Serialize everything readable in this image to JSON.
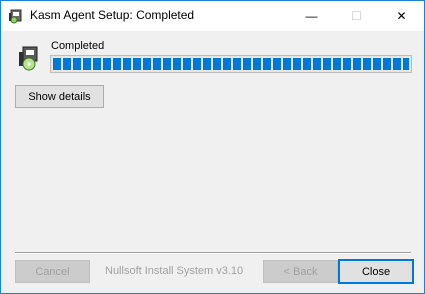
{
  "window": {
    "title": "Kasm Agent Setup: Completed",
    "border_color": "#1883d7"
  },
  "titlebar": {
    "icons": {
      "app": "installer-icon",
      "minimize": "minimize-icon",
      "maximize": "maximize-icon",
      "close": "close-icon"
    },
    "minimize_glyph": "—",
    "maximize_glyph": "☐",
    "close_glyph": "✕"
  },
  "main": {
    "status_text": "Completed",
    "progress_percent": 100,
    "progress_color": "#0078d7",
    "show_details_label": "Show details"
  },
  "footer": {
    "branding": "Nullsoft Install System v3.10",
    "cancel_label": "Cancel",
    "back_label": "< Back",
    "close_label": "Close"
  }
}
